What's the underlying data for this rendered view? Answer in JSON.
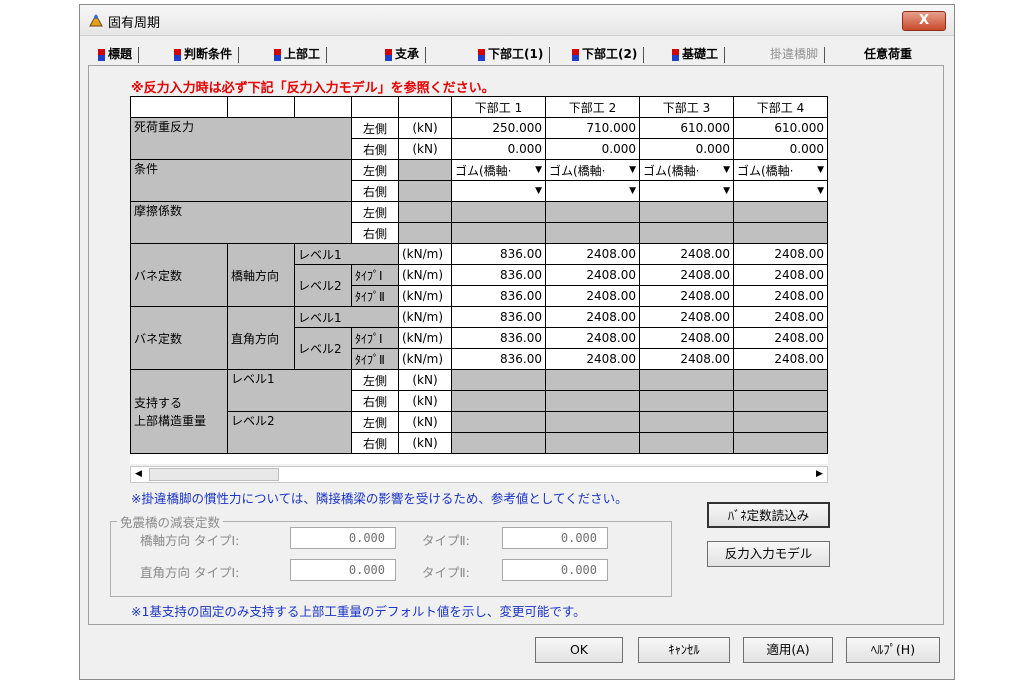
{
  "window": {
    "title": "固有周期",
    "close_label": "X"
  },
  "tabs": [
    {
      "label": "標題",
      "flag": true,
      "disabled": false
    },
    {
      "label": "判断条件",
      "flag": true,
      "disabled": false
    },
    {
      "label": "上部工",
      "flag": true,
      "disabled": false
    },
    {
      "label": "支承",
      "flag": true,
      "disabled": false,
      "active": true
    },
    {
      "label": "下部工(1)",
      "flag": true,
      "disabled": false
    },
    {
      "label": "下部工(2)",
      "flag": true,
      "disabled": false
    },
    {
      "label": "基礎工",
      "flag": true,
      "disabled": false
    },
    {
      "label": "掛違橋脚",
      "flag": false,
      "disabled": true
    },
    {
      "label": "任意荷重",
      "flag": false,
      "disabled": false
    }
  ],
  "warning": "※反力入力時は必ず下記「反力入力モデル」を参照ください。",
  "grid": {
    "columns": [
      "下部工 1",
      "下部工 2",
      "下部工 3",
      "下部工 4"
    ],
    "dead_load": {
      "label": "死荷重反力",
      "left": "左側",
      "right": "右側",
      "unit": "(kN)",
      "left_values": [
        "250.000",
        "710.000",
        "610.000",
        "610.000"
      ],
      "right_values": [
        "0.000",
        "0.000",
        "0.000",
        "0.000"
      ]
    },
    "condition": {
      "label": "条件",
      "left": "左側",
      "right": "右側",
      "left_values": [
        "ゴム(橋軸·",
        "ゴム(橋軸·",
        "ゴム(橋軸·",
        "ゴム(橋軸·"
      ],
      "right_values": [
        "",
        "",
        "",
        ""
      ]
    },
    "friction": {
      "label": "摩擦係数",
      "left": "左側",
      "right": "右側"
    },
    "spring1": {
      "label": "バネ定数",
      "dir": "橋軸方向",
      "level1": "レベル1",
      "level2": "レベル2",
      "type1": "ﾀｲﾌﾟⅠ",
      "type2": "ﾀｲﾌﾟⅡ",
      "unit": "(kN/m)",
      "rows": [
        [
          "836.00",
          "2408.00",
          "2408.00",
          "2408.00"
        ],
        [
          "836.00",
          "2408.00",
          "2408.00",
          "2408.00"
        ],
        [
          "836.00",
          "2408.00",
          "2408.00",
          "2408.00"
        ]
      ]
    },
    "spring2": {
      "label": "バネ定数",
      "dir": "直角方向",
      "level1": "レベル1",
      "level2": "レベル2",
      "type1": "ﾀｲﾌﾟⅠ",
      "type2": "ﾀｲﾌﾟⅡ",
      "unit": "(kN/m)",
      "rows": [
        [
          "836.00",
          "2408.00",
          "2408.00",
          "2408.00"
        ],
        [
          "836.00",
          "2408.00",
          "2408.00",
          "2408.00"
        ],
        [
          "836.00",
          "2408.00",
          "2408.00",
          "2408.00"
        ]
      ]
    },
    "support": {
      "label1": "支持する",
      "label2": "上部構造重量",
      "level1": "レベル1",
      "level2": "レベル2",
      "left": "左側",
      "right": "右側",
      "unit": "(kN)"
    }
  },
  "note1": "※掛違橋脚の慣性力については、隣接橋梁の影響を受けるため、参考値としてください。",
  "damping": {
    "title": "免震橋の減衰定数",
    "row1_label": "橋軸方向 タイプⅠ:",
    "row1_type2": "タイプⅡ:",
    "row2_label": "直角方向 タイプⅠ:",
    "row2_type2": "タイプⅡ:",
    "values": [
      "0.000",
      "0.000",
      "0.000",
      "0.000"
    ]
  },
  "buttons": {
    "spring_load": "ﾊﾞﾈ定数読込み",
    "reaction_model": "反力入力モデル",
    "ok": "OK",
    "cancel": "ｷｬﾝｾﾙ",
    "apply": "適用(A)",
    "help": "ﾍﾙﾌﾟ(H)"
  },
  "note2": "※1基支持の固定のみ支持する上部工重量のデフォルト値を示し、変更可能です。"
}
